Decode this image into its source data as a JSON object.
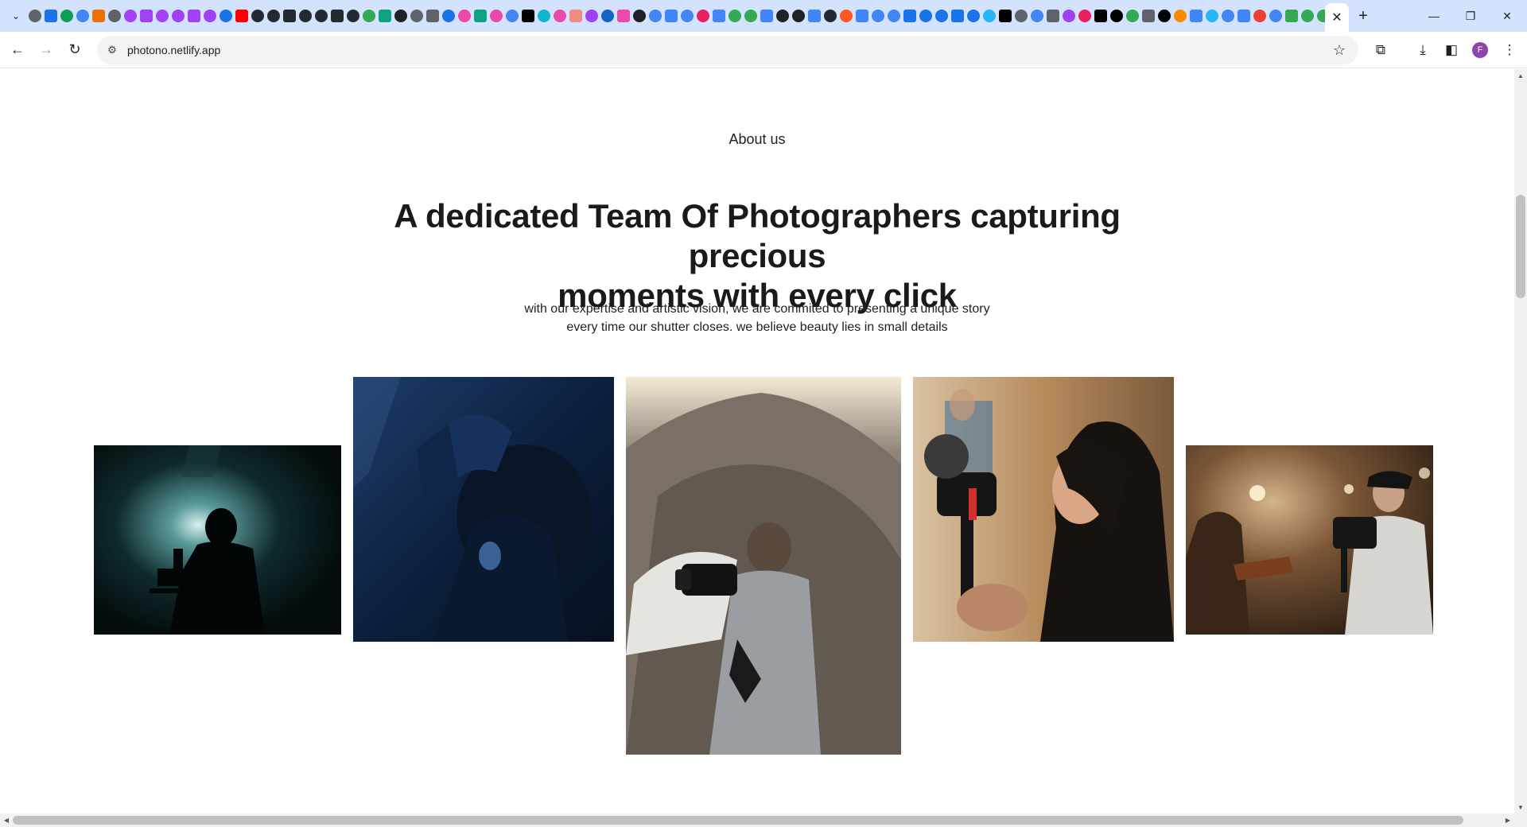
{
  "browser": {
    "url": "photono.netlify.app",
    "profile_initial": "F",
    "active_tab_close_glyph": "✕",
    "newtab_glyph": "+",
    "window_controls": {
      "minimize": "—",
      "restore": "❐",
      "close": "✕"
    },
    "toolbar_icons": [
      "back-icon",
      "forward-icon",
      "reload-icon",
      "site-info-icon",
      "bookmark-star-icon",
      "extensions-icon",
      "downloads-icon",
      "side-panel-icon",
      "menu-icon"
    ],
    "pinned_favicon_colors": [
      "#5f6368",
      "#1a73e8",
      "#0f9d58",
      "#4285f4",
      "#e8710a",
      "#5f6368",
      "#a142f4",
      "#a142f4",
      "#a142f4",
      "#a142f4",
      "#a142f4",
      "#a142f4",
      "#1a73e8",
      "#ff0000",
      "#24292f",
      "#24292f",
      "#24292f",
      "#24292f",
      "#24292f",
      "#24292f",
      "#24292f",
      "#34a853",
      "#10a37f",
      "#202124",
      "#5f6368",
      "#5f6368",
      "#1a73e8",
      "#ea4aaa",
      "#10a37f",
      "#ea4aaa",
      "#4285f4",
      "#000000",
      "#12b5cb",
      "#ea4aaa",
      "#f28b82",
      "#a142f4",
      "#1565c0",
      "#ea4aaa",
      "#202124",
      "#4285f4",
      "#4285f4",
      "#4285f4",
      "#e91e63",
      "#4285f4",
      "#34a853",
      "#34a853",
      "#4285f4",
      "#202124",
      "#202124",
      "#4285f4",
      "#24292f",
      "#ff5722",
      "#4285f4",
      "#4285f4",
      "#4285f4",
      "#1a73e8",
      "#1a73e8",
      "#1a73e8",
      "#1a73e8",
      "#1a73e8",
      "#29b6f6",
      "#000000",
      "#5f6368",
      "#4285f4",
      "#5f6368",
      "#a142f4",
      "#e91e63",
      "#000000",
      "#000000",
      "#34a853",
      "#5f6368",
      "#000000",
      "#fb8c00",
      "#4285f4",
      "#29b6f6",
      "#4285f4",
      "#4285f4",
      "#ea4335",
      "#4285f4",
      "#34a853",
      "#34a853",
      "#34a853",
      "#00bcd4"
    ]
  },
  "page": {
    "section_label": "About us",
    "headline_line1": "A dedicated Team Of Photographers capturing precious",
    "headline_line2": "moments with every click",
    "subtext_line1": "with our expertise and artistic vision, we are commited to presenting a unique story",
    "subtext_line2": "every time our shutter closes. we believe beauty lies in small details",
    "photos": [
      {
        "name": "silhouette-videographer-photo"
      },
      {
        "name": "blue-lit-photographer-photo"
      },
      {
        "name": "mountain-photographer-photo"
      },
      {
        "name": "woman-with-camera-rig-photo"
      },
      {
        "name": "violinist-and-cameraman-photo"
      }
    ]
  }
}
